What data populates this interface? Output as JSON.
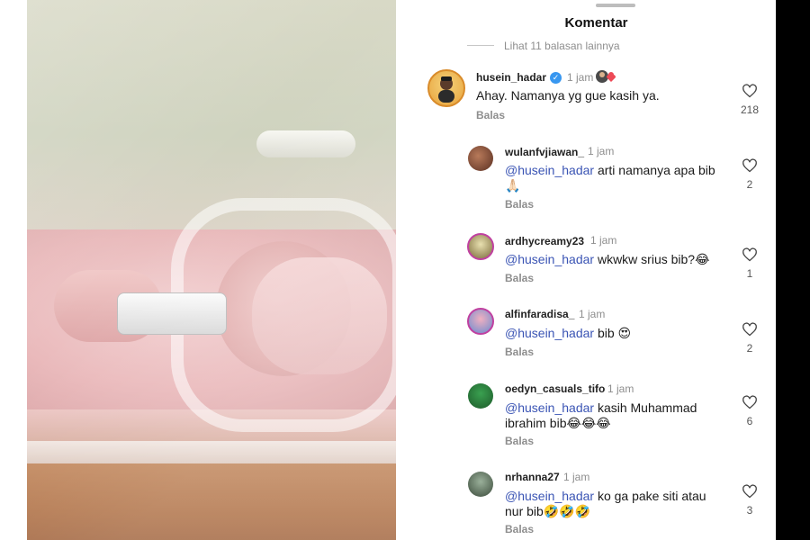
{
  "sheet": {
    "title": "Komentar",
    "view_more": "Lihat 11 balasan lainnya"
  },
  "main_comment": {
    "username": "husein_hadar",
    "time": "1 jam",
    "text": "Ahay. Namanya yg gue kasih ya.",
    "reply_label": "Balas",
    "likes": "218"
  },
  "replies": [
    {
      "username": "wulanfvjiawan_",
      "time": "1 jam",
      "mention": "@husein_hadar",
      "text": " arti namanya apa bib",
      "text2": "🙏🏻",
      "reply_label": "Balas",
      "likes": "2"
    },
    {
      "username": "ardhycreamy23",
      "time": "1 jam",
      "mention": "@husein_hadar",
      "text": " wkwkw srius bib?😂",
      "reply_label": "Balas",
      "likes": "1"
    },
    {
      "username": "alfinfaradisa_",
      "time": "1 jam",
      "mention": "@husein_hadar",
      "text": " bib 😍",
      "reply_label": "Balas",
      "likes": "2"
    },
    {
      "username": "oedyn_casuals_tifo",
      "time": "1 jam",
      "mention": "@husein_hadar",
      "text": " kasih Muhammad",
      "text2": "ibrahim bib😂😂😂",
      "reply_label": "Balas",
      "likes": "6"
    },
    {
      "username": "nrhanna27",
      "time": "1 jam",
      "mention": "@husein_hadar",
      "text": " ko ga pake siti atau",
      "text2": "nur bib🤣🤣🤣",
      "reply_label": "Balas",
      "likes": "3"
    }
  ],
  "colors": {
    "mention": "#3a54b4",
    "muted": "#8e8e8e",
    "verified": "#3897f0"
  }
}
